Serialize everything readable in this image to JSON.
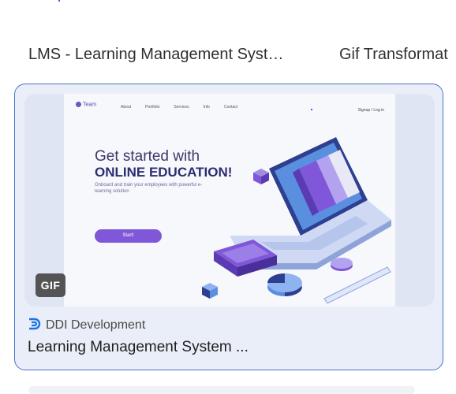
{
  "previous_row": {
    "title_left": "LMS - Learning Management Syst…",
    "title_right": "Gif Transformat"
  },
  "card": {
    "badge": "GIF",
    "source_name": "DDI Development",
    "title": "Learning Management System ...",
    "thumbnail": {
      "brand": "Team",
      "nav_links": [
        "About",
        "Portfolio",
        "Services",
        "Info",
        "Contact"
      ],
      "signup": "Signup / Log in",
      "headline_1": "Get started with",
      "headline_2": "ONLINE EDUCATION!",
      "subtext": "Onboard and train your employees with powerful e-learning solution",
      "button": "Start!"
    }
  },
  "colors": {
    "card_border": "#4a74c9",
    "card_bg": "#e9eef8",
    "accent_purple": "#7f57d8",
    "source_icon": "#1a73e8"
  }
}
